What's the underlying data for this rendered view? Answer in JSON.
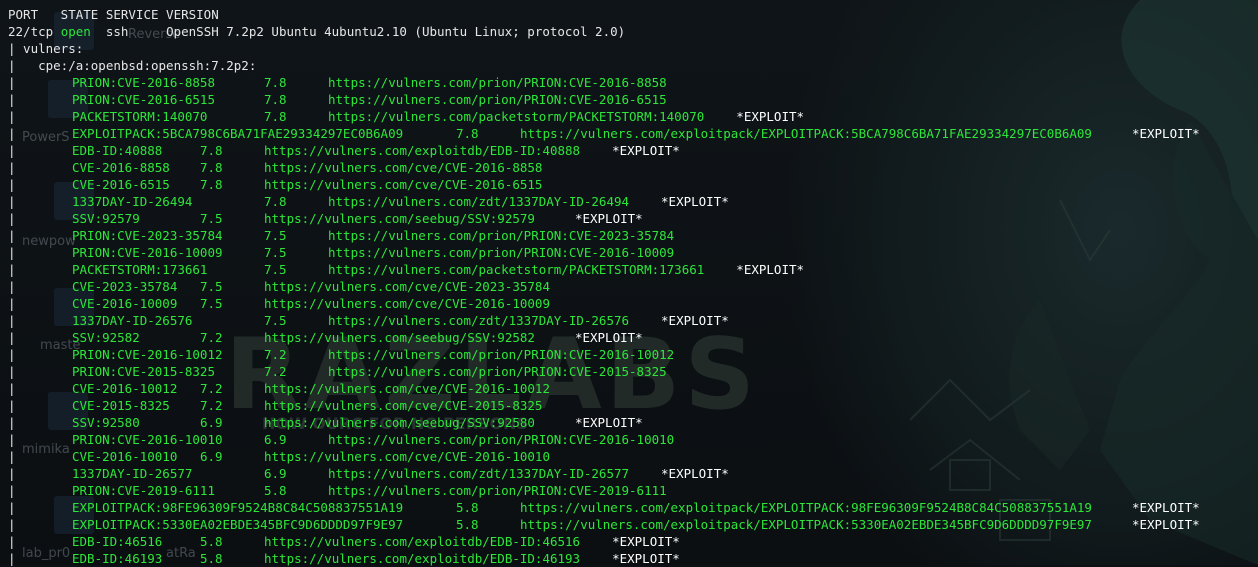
{
  "colors": {
    "terminal_green": "#2ee63a",
    "terminal_white": "#e6e6e6",
    "background": "#0d1115"
  },
  "desktop": {
    "labels": [
      "Reverse",
      "PowerS",
      "newpow",
      "maste",
      "mimika",
      "lab_pr0",
      "atRa"
    ],
    "watermark_text": "RAZLABS",
    "watermark_tagline": "HOW OURC FOR NG PERSONS"
  },
  "terminal": {
    "header": "PORT   STATE SERVICE VERSION",
    "port_line": {
      "port": "22/tcp",
      "state": "open",
      "service": "ssh",
      "version": "OpenSSH 7.2p2 Ubuntu 4ubuntu2.10 (Ubuntu Linux; protocol 2.0)"
    },
    "script_name": "| vulners:",
    "cpe": "|   cpe:/a:openbsd:openssh:7.2p2:",
    "pipe_char": "|",
    "entries": [
      {
        "id": "PRION:CVE-2016-8858",
        "score": "7.8",
        "url": "https://vulners.com/prion/PRION:CVE-2016-8858",
        "exploit": ""
      },
      {
        "id": "PRION:CVE-2016-6515",
        "score": "7.8",
        "url": "https://vulners.com/prion/PRION:CVE-2016-6515",
        "exploit": ""
      },
      {
        "id": "PACKETSTORM:140070",
        "score": "7.8",
        "url": "https://vulners.com/packetstorm/PACKETSTORM:140070",
        "exploit": "*EXPLOIT*"
      },
      {
        "id": "EXPLOITPACK:5BCA798C6BA71FAE29334297EC0B6A09",
        "score": "7.8",
        "url": "https://vulners.com/exploitpack/EXPLOITPACK:5BCA798C6BA71FAE29334297EC0B6A09",
        "exploit": "*EXPLOIT*"
      },
      {
        "id": "EDB-ID:40888",
        "score": "7.8",
        "url": "https://vulners.com/exploitdb/EDB-ID:40888",
        "exploit": "*EXPLOIT*"
      },
      {
        "id": "CVE-2016-8858",
        "score": "7.8",
        "url": "https://vulners.com/cve/CVE-2016-8858",
        "exploit": ""
      },
      {
        "id": "CVE-2016-6515",
        "score": "7.8",
        "url": "https://vulners.com/cve/CVE-2016-6515",
        "exploit": ""
      },
      {
        "id": "1337DAY-ID-26494",
        "score": "7.8",
        "url": "https://vulners.com/zdt/1337DAY-ID-26494",
        "exploit": "*EXPLOIT*"
      },
      {
        "id": "SSV:92579",
        "score": "7.5",
        "url": "https://vulners.com/seebug/SSV:92579",
        "exploit": "*EXPLOIT*"
      },
      {
        "id": "PRION:CVE-2023-35784",
        "score": "7.5",
        "url": "https://vulners.com/prion/PRION:CVE-2023-35784",
        "exploit": ""
      },
      {
        "id": "PRION:CVE-2016-10009",
        "score": "7.5",
        "url": "https://vulners.com/prion/PRION:CVE-2016-10009",
        "exploit": ""
      },
      {
        "id": "PACKETSTORM:173661",
        "score": "7.5",
        "url": "https://vulners.com/packetstorm/PACKETSTORM:173661",
        "exploit": "*EXPLOIT*"
      },
      {
        "id": "CVE-2023-35784",
        "score": "7.5",
        "url": "https://vulners.com/cve/CVE-2023-35784",
        "exploit": ""
      },
      {
        "id": "CVE-2016-10009",
        "score": "7.5",
        "url": "https://vulners.com/cve/CVE-2016-10009",
        "exploit": ""
      },
      {
        "id": "1337DAY-ID-26576",
        "score": "7.5",
        "url": "https://vulners.com/zdt/1337DAY-ID-26576",
        "exploit": "*EXPLOIT*"
      },
      {
        "id": "SSV:92582",
        "score": "7.2",
        "url": "https://vulners.com/seebug/SSV:92582",
        "exploit": "*EXPLOIT*"
      },
      {
        "id": "PRION:CVE-2016-10012",
        "score": "7.2",
        "url": "https://vulners.com/prion/PRION:CVE-2016-10012",
        "exploit": ""
      },
      {
        "id": "PRION:CVE-2015-8325",
        "score": "7.2",
        "url": "https://vulners.com/prion/PRION:CVE-2015-8325",
        "exploit": ""
      },
      {
        "id": "CVE-2016-10012",
        "score": "7.2",
        "url": "https://vulners.com/cve/CVE-2016-10012",
        "exploit": ""
      },
      {
        "id": "CVE-2015-8325",
        "score": "7.2",
        "url": "https://vulners.com/cve/CVE-2015-8325",
        "exploit": ""
      },
      {
        "id": "SSV:92580",
        "score": "6.9",
        "url": "https://vulners.com/seebug/SSV:92580",
        "exploit": "*EXPLOIT*"
      },
      {
        "id": "PRION:CVE-2016-10010",
        "score": "6.9",
        "url": "https://vulners.com/prion/PRION:CVE-2016-10010",
        "exploit": ""
      },
      {
        "id": "CVE-2016-10010",
        "score": "6.9",
        "url": "https://vulners.com/cve/CVE-2016-10010",
        "exploit": ""
      },
      {
        "id": "1337DAY-ID-26577",
        "score": "6.9",
        "url": "https://vulners.com/zdt/1337DAY-ID-26577",
        "exploit": "*EXPLOIT*"
      },
      {
        "id": "PRION:CVE-2019-6111",
        "score": "5.8",
        "url": "https://vulners.com/prion/PRION:CVE-2019-6111",
        "exploit": ""
      },
      {
        "id": "EXPLOITPACK:98FE96309F9524B8C84C508837551A19",
        "score": "5.8",
        "url": "https://vulners.com/exploitpack/EXPLOITPACK:98FE96309F9524B8C84C508837551A19",
        "exploit": "*EXPLOIT*"
      },
      {
        "id": "EXPLOITPACK:5330EA02EBDE345BFC9D6DDDD97F9E97",
        "score": "5.8",
        "url": "https://vulners.com/exploitpack/EXPLOITPACK:5330EA02EBDE345BFC9D6DDDD97F9E97",
        "exploit": "*EXPLOIT*"
      },
      {
        "id": "EDB-ID:46516",
        "score": "5.8",
        "url": "https://vulners.com/exploitdb/EDB-ID:46516",
        "exploit": "*EXPLOIT*"
      },
      {
        "id": "EDB-ID:46193",
        "score": "5.8",
        "url": "https://vulners.com/exploitdb/EDB-ID:46193",
        "exploit": "*EXPLOIT*"
      }
    ]
  }
}
